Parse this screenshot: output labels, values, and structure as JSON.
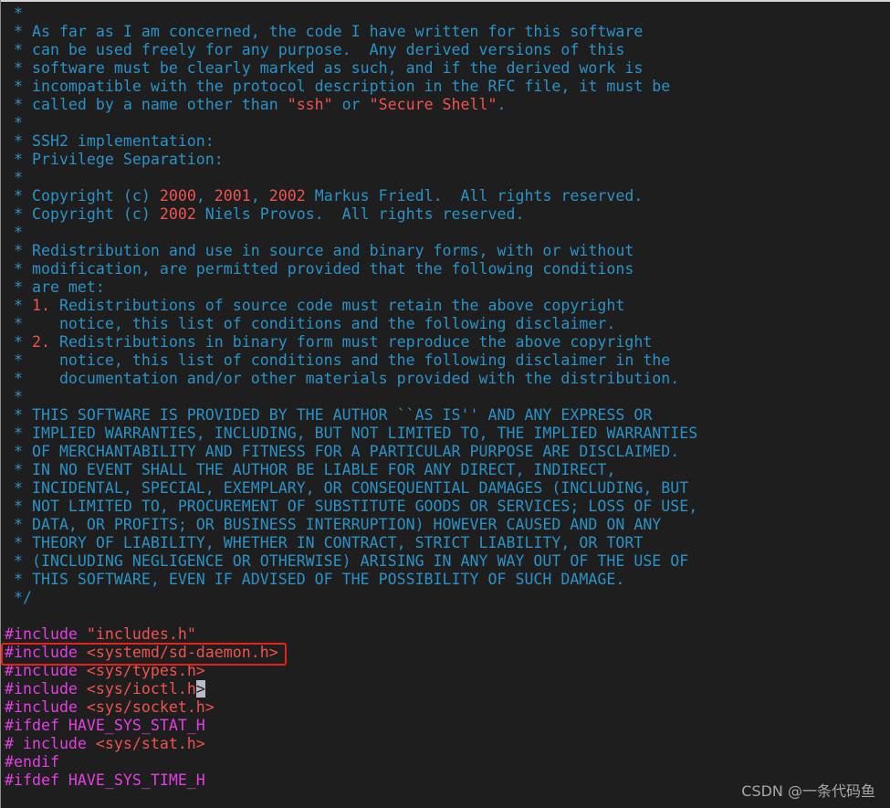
{
  "editor": {
    "comment_lines": [
      [
        {
          "t": " *",
          "k": "c"
        }
      ],
      [
        {
          "t": " * As far as I am concerned, the code I have written for this software",
          "k": "c"
        }
      ],
      [
        {
          "t": " * can be used freely for any purpose.  Any derived versions of this",
          "k": "c"
        }
      ],
      [
        {
          "t": " * software must be clearly marked as such, and if the derived work is",
          "k": "c"
        }
      ],
      [
        {
          "t": " * incompatible with the protocol description in the RFC file, it must be",
          "k": "c"
        }
      ],
      [
        {
          "t": " * called by a name other than ",
          "k": "c"
        },
        {
          "t": "\"ssh\"",
          "k": "str"
        },
        {
          "t": " or ",
          "k": "c"
        },
        {
          "t": "\"Secure Shell\"",
          "k": "str"
        },
        {
          "t": ".",
          "k": "c"
        }
      ],
      [
        {
          "t": " *",
          "k": "c"
        }
      ],
      [
        {
          "t": " * SSH2 implementation:",
          "k": "c"
        }
      ],
      [
        {
          "t": " * Privilege Separation:",
          "k": "c"
        }
      ],
      [
        {
          "t": " *",
          "k": "c"
        }
      ],
      [
        {
          "t": " * Copyright (c) ",
          "k": "c"
        },
        {
          "t": "2000",
          "k": "num"
        },
        {
          "t": ", ",
          "k": "c"
        },
        {
          "t": "2001",
          "k": "num"
        },
        {
          "t": ", ",
          "k": "c"
        },
        {
          "t": "2002",
          "k": "num"
        },
        {
          "t": " Markus Friedl.  All rights reserved.",
          "k": "c"
        }
      ],
      [
        {
          "t": " * Copyright (c) ",
          "k": "c"
        },
        {
          "t": "2002",
          "k": "num"
        },
        {
          "t": " Niels Provos.  All rights reserved.",
          "k": "c"
        }
      ],
      [
        {
          "t": " *",
          "k": "c"
        }
      ],
      [
        {
          "t": " * Redistribution and use in source and binary forms, with or without",
          "k": "c"
        }
      ],
      [
        {
          "t": " * modification, are permitted provided that the following conditions",
          "k": "c"
        }
      ],
      [
        {
          "t": " * are met:",
          "k": "c"
        }
      ],
      [
        {
          "t": " * ",
          "k": "c"
        },
        {
          "t": "1.",
          "k": "num"
        },
        {
          "t": " Redistributions of source code must retain the above copyright",
          "k": "c"
        }
      ],
      [
        {
          "t": " *    notice, this list of conditions and the following disclaimer.",
          "k": "c"
        }
      ],
      [
        {
          "t": " * ",
          "k": "c"
        },
        {
          "t": "2.",
          "k": "num"
        },
        {
          "t": " Redistributions in binary form must reproduce the above copyright",
          "k": "c"
        }
      ],
      [
        {
          "t": " *    notice, this list of conditions and the following disclaimer in the",
          "k": "c"
        }
      ],
      [
        {
          "t": " *    documentation and/or other materials provided with the distribution.",
          "k": "c"
        }
      ],
      [
        {
          "t": " *",
          "k": "c"
        }
      ],
      [
        {
          "t": " * THIS SOFTWARE IS PROVIDED BY THE AUTHOR ``AS IS'' AND ANY EXPRESS OR",
          "k": "c"
        }
      ],
      [
        {
          "t": " * IMPLIED WARRANTIES, INCLUDING, BUT NOT LIMITED TO, THE IMPLIED WARRANTIES",
          "k": "c"
        }
      ],
      [
        {
          "t": " * OF MERCHANTABILITY AND FITNESS FOR A PARTICULAR PURPOSE ARE DISCLAIMED.",
          "k": "c"
        }
      ],
      [
        {
          "t": " * IN NO EVENT SHALL THE AUTHOR BE LIABLE FOR ANY DIRECT, INDIRECT,",
          "k": "c"
        }
      ],
      [
        {
          "t": " * INCIDENTAL, SPECIAL, EXEMPLARY, OR CONSEQUENTIAL DAMAGES (INCLUDING, BUT",
          "k": "c"
        }
      ],
      [
        {
          "t": " * NOT LIMITED TO, PROCUREMENT OF SUBSTITUTE GOODS OR SERVICES; LOSS OF USE,",
          "k": "c"
        }
      ],
      [
        {
          "t": " * DATA, OR PROFITS; OR BUSINESS INTERRUPTION) HOWEVER CAUSED AND ON ANY",
          "k": "c"
        }
      ],
      [
        {
          "t": " * THEORY OF LIABILITY, WHETHER IN CONTRACT, STRICT LIABILITY, OR TORT",
          "k": "c"
        }
      ],
      [
        {
          "t": " * (INCLUDING NEGLIGENCE OR OTHERWISE) ARISING IN ANY WAY OUT OF THE USE OF",
          "k": "c"
        }
      ],
      [
        {
          "t": " * THIS SOFTWARE, EVEN IF ADVISED OF THE POSSIBILITY OF SUCH DAMAGE.",
          "k": "c"
        }
      ],
      [
        {
          "t": " */",
          "k": "c"
        }
      ],
      [
        {
          "t": "",
          "k": "c"
        }
      ]
    ],
    "code_lines": [
      [
        {
          "t": "#include ",
          "k": "pp"
        },
        {
          "t": "\"includes.h\"",
          "k": "str"
        }
      ],
      [
        {
          "t": "#include ",
          "k": "pp"
        },
        {
          "t": "<systemd/sd-daemon.h>",
          "k": "str"
        }
      ],
      [
        {
          "t": "#include ",
          "k": "pp"
        },
        {
          "t": "<sys/types.h>",
          "k": "str"
        }
      ],
      [
        {
          "t": "#include ",
          "k": "pp"
        },
        {
          "t": "<sys/ioctl.h",
          "k": "str"
        },
        {
          "t": ">",
          "k": "cursor"
        }
      ],
      [
        {
          "t": "#include ",
          "k": "pp"
        },
        {
          "t": "<sys/socket.h>",
          "k": "str"
        }
      ],
      [
        {
          "t": "#ifdef HAVE_SYS_STAT_H",
          "k": "pp"
        }
      ],
      [
        {
          "t": "# include ",
          "k": "pp"
        },
        {
          "t": "<sys/stat.h>",
          "k": "str"
        }
      ],
      [
        {
          "t": "#endif",
          "k": "pp"
        }
      ],
      [
        {
          "t": "#ifdef HAVE_SYS_TIME_H",
          "k": "pp"
        }
      ]
    ],
    "highlighted_line": "#include <systemd/sd-daemon.h>"
  },
  "watermark": "CSDN @一条代码鱼"
}
